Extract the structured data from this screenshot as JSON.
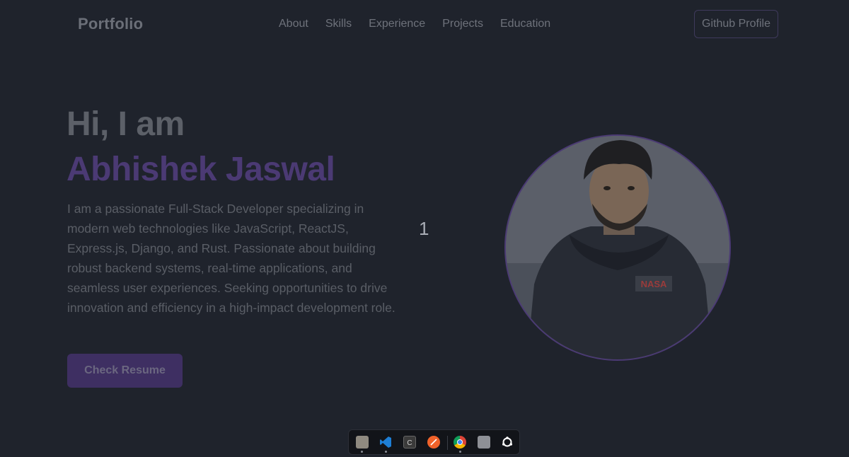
{
  "navbar": {
    "brand": "Portfolio",
    "links": [
      "About",
      "Skills",
      "Experience",
      "Projects",
      "Education"
    ],
    "github_label": "Github Profile"
  },
  "hero": {
    "greeting": "Hi, I am",
    "name": "Abhishek Jaswal",
    "bio": "I am a passionate Full-Stack Developer specializing in modern web technologies like JavaScript, ReactJS, Express.js, Django, and Rust. Passionate about building robust backend systems, real-time applications, and seamless user experiences. Seeking opportunities to drive innovation and efficiency in a high-impact development role.",
    "cta_label": "Check Resume",
    "counter": "1"
  },
  "avatar": {
    "shirt_logo": "NASA"
  },
  "dock": {
    "apps": [
      "files-icon",
      "vscode-icon",
      "terminal-icon",
      "postman-icon",
      "chrome-icon",
      "document-icon",
      "ubuntu-icon"
    ]
  },
  "colors": {
    "background": "#1f232c",
    "accent": "#4b3a74",
    "button": "#3e2f62"
  }
}
